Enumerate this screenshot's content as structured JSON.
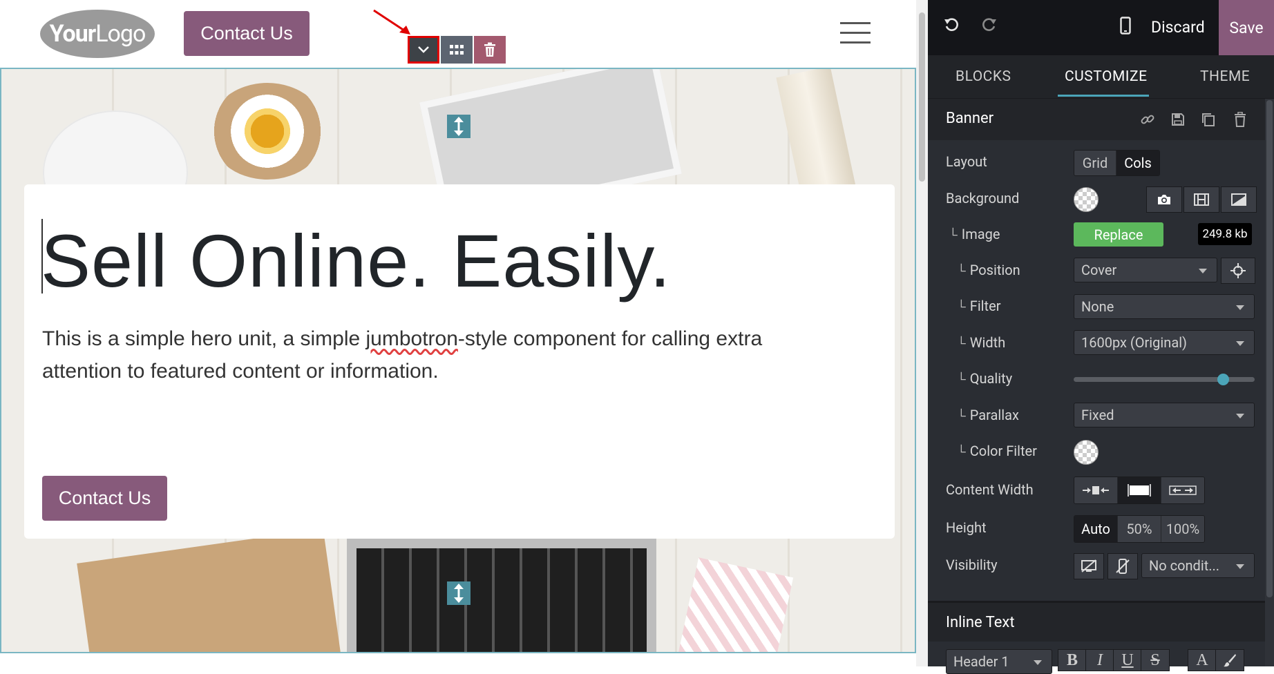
{
  "site": {
    "logo_bold": "Your",
    "logo_light": "Logo",
    "header_contact_label": "Contact Us",
    "hero": {
      "title": "Sell Online. Easily.",
      "text_before": "This is a simple hero unit, a simple ",
      "text_misspelled": "jumbotron",
      "text_after": "-style component for calling extra attention to featured content or information.",
      "contact_label": "Contact Us"
    },
    "toolbar_icons": [
      "chevron-down-icon",
      "grid-icon",
      "trash-icon"
    ]
  },
  "editor": {
    "discard_label": "Discard",
    "save_label": "Save",
    "tabs": [
      {
        "label": "BLOCKS"
      },
      {
        "label": "CUSTOMIZE",
        "active": true
      },
      {
        "label": "THEME"
      }
    ],
    "section": {
      "title": "Banner",
      "icons": [
        "link-icon",
        "save-icon",
        "copy-icon",
        "trash-icon"
      ]
    },
    "options": {
      "layout": {
        "label": "Layout",
        "choices": [
          "Grid",
          "Cols"
        ],
        "active": "Cols"
      },
      "background": {
        "label": "Background"
      },
      "image": {
        "label": "Image",
        "replace_label": "Replace",
        "size": "249.8 kb"
      },
      "position": {
        "label": "Position",
        "value": "Cover"
      },
      "filter": {
        "label": "Filter",
        "value": "None"
      },
      "width": {
        "label": "Width",
        "value": "1600px (Original)"
      },
      "quality": {
        "label": "Quality",
        "value_fraction": 0.85
      },
      "parallax": {
        "label": "Parallax",
        "value": "Fixed"
      },
      "color_filter": {
        "label": "Color Filter"
      },
      "content_width": {
        "label": "Content Width"
      },
      "height": {
        "label": "Height",
        "choices": [
          "Auto",
          "50%",
          "100%"
        ],
        "active": "Auto"
      },
      "visibility": {
        "label": "Visibility",
        "value": "No condit..."
      }
    },
    "inline_text": {
      "title": "Inline Text",
      "style_value": "Header 1",
      "format_buttons": [
        "B",
        "I",
        "U",
        "S",
        "A"
      ]
    }
  },
  "colors": {
    "brand_purple": "#875a7b",
    "accent_teal": "#4ba5b9",
    "replace_green": "#5cb85c",
    "panel_dark": "#2a2d33"
  }
}
